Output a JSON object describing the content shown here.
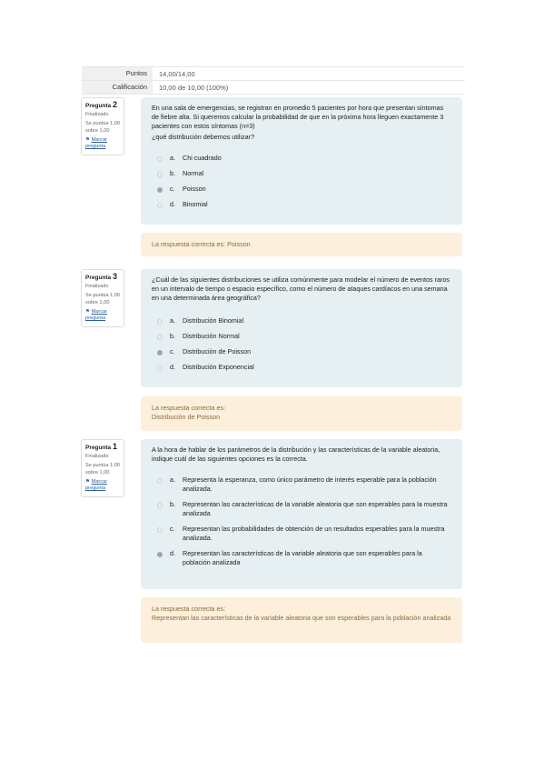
{
  "summary": {
    "points_label": "Puntos",
    "points_value": "14,00/14,00",
    "grade_label": "Calificación",
    "grade_value": "10,00 de 10,00 (100%)"
  },
  "questions": [
    {
      "title_prefix": "Pregunta",
      "number": "2",
      "state": "Finalizado",
      "grade": "Se puntúa 1,00 sobre 1,00",
      "flag_icon": "⚑",
      "flag_label": "Marcar pregunta",
      "text": "En una sala de emergencias, se registran en promedio 5 pacientes por hora que presentan síntomas de fiebre alta. Si queremos calcular la probabilidad de que en la próxima hora lleguen exactamente 3 pacientes con estos síntomas (n=3)",
      "subtext": "¿qué distribución debemos utilizar?",
      "options": [
        {
          "letter": "a.",
          "text": "Chi cuadrado",
          "selected": false
        },
        {
          "letter": "b.",
          "text": "Normal",
          "selected": false
        },
        {
          "letter": "c.",
          "text": "Poisson",
          "selected": true
        },
        {
          "letter": "d.",
          "text": "Binomial",
          "selected": false
        }
      ],
      "feedback_line1": "La respuesta correcta es: Poisson",
      "feedback_line2": ""
    },
    {
      "title_prefix": "Pregunta",
      "number": "3",
      "state": "Finalizado",
      "grade": "Se puntúa 1,00 sobre 1,00",
      "flag_icon": "⚑",
      "flag_label": "Marcar pregunta",
      "text": "¿Cuál de las siguientes distribuciones se utiliza comúnmente para modelar el número de eventos raros en un intervalo de tiempo o espacio específico, como el número de ataques cardíacos en una semana en una determinada área geográfica?",
      "subtext": "",
      "options": [
        {
          "letter": "a.",
          "text": "Distribución Binomial",
          "selected": false
        },
        {
          "letter": "b.",
          "text": "Distribución Normal",
          "selected": false
        },
        {
          "letter": "c.",
          "text": "Distribución de Poisson",
          "selected": true
        },
        {
          "letter": "d.",
          "text": "Distribución Exponencial",
          "selected": false
        }
      ],
      "feedback_line1": "La respuesta correcta es:",
      "feedback_line2": "Distribución de Poisson"
    },
    {
      "title_prefix": "Pregunta",
      "number": "1",
      "state": "Finalizado",
      "grade": "Se puntúa 1,00 sobre 1,00",
      "flag_icon": "⚑",
      "flag_label": "Marcar pregunta",
      "text": "A la hora de hablar de los parámetros de la distribución y las características de la variable aleatoria, indique cuál de las siguientes opciones es la correcta.",
      "subtext": "",
      "options": [
        {
          "letter": "a.",
          "text": "Representa la esperanza, como único parámetro de interés esperable para la población analizada.",
          "selected": false
        },
        {
          "letter": "b.",
          "text": "Representan las características de la variable aleatoria que son esperables para la muestra analizada",
          "selected": false
        },
        {
          "letter": "c.",
          "text": "Representan las probabilidades de obtención de un resultados esperables para la muestra analizada.",
          "selected": false
        },
        {
          "letter": "d.",
          "text": "Representan las características de la variable aleatoria que son esperables para la población analizada",
          "selected": true
        }
      ],
      "feedback_line1": "La respuesta correcta es:",
      "feedback_line2": "Representan las características de la variable aleatoria que son esperables para la población analizada"
    }
  ]
}
